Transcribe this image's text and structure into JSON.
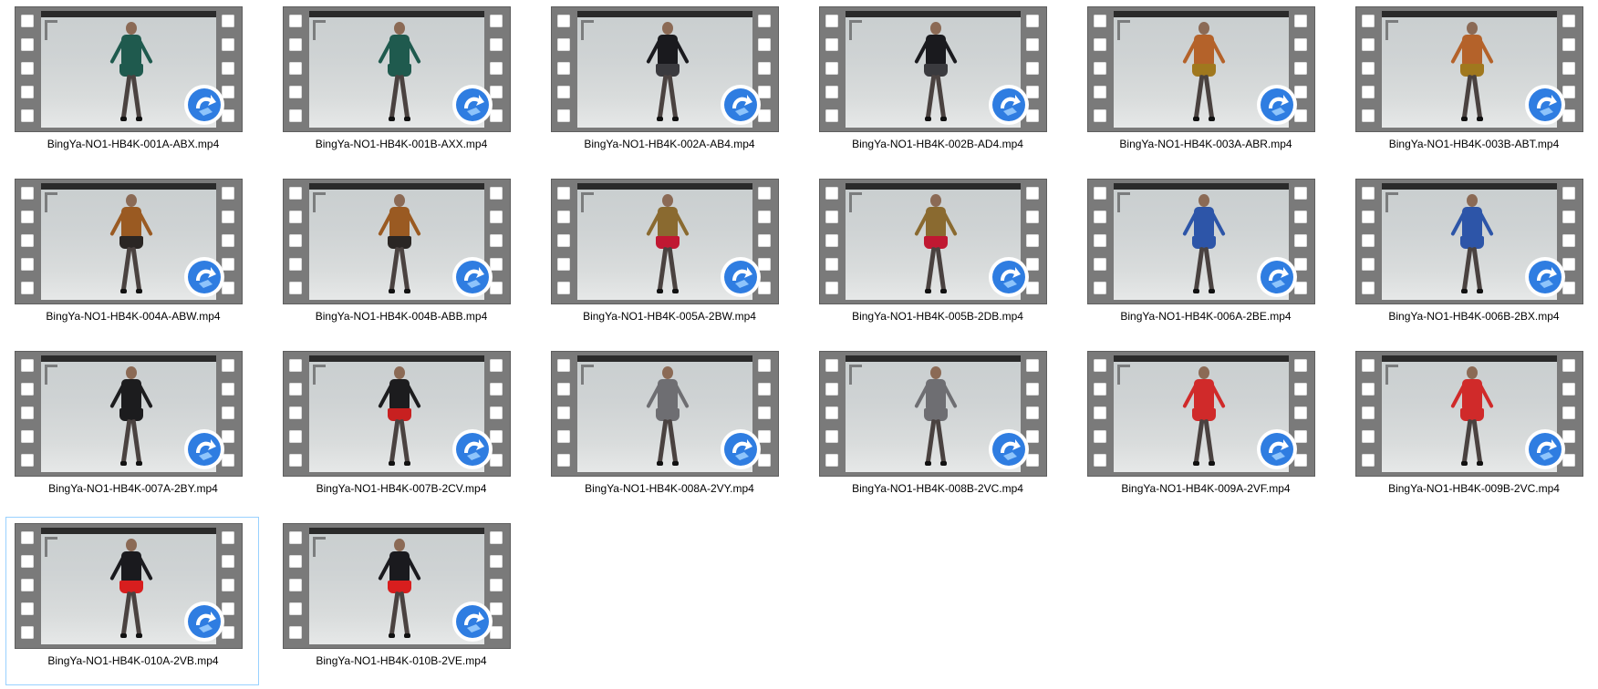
{
  "files": [
    {
      "name": "BingYa-NO1-HB4K-001A-ABX.mp4",
      "top_color": "#1f5a4e",
      "bottom_color": "#1f5a4e",
      "selected": false
    },
    {
      "name": "BingYa-NO1-HB4K-001B-AXX.mp4",
      "top_color": "#1f5a4e",
      "bottom_color": "#1f5a4e",
      "selected": false
    },
    {
      "name": "BingYa-NO1-HB4K-002A-AB4.mp4",
      "top_color": "#1a1a1e",
      "bottom_color": "#3a3a3e",
      "selected": false
    },
    {
      "name": "BingYa-NO1-HB4K-002B-AD4.mp4",
      "top_color": "#1a1a1e",
      "bottom_color": "#3a3a3e",
      "selected": false
    },
    {
      "name": "BingYa-NO1-HB4K-003A-ABR.mp4",
      "top_color": "#b4622a",
      "bottom_color": "#a0781e",
      "selected": false
    },
    {
      "name": "BingYa-NO1-HB4K-003B-ABT.mp4",
      "top_color": "#b4622a",
      "bottom_color": "#a0781e",
      "selected": false
    },
    {
      "name": "BingYa-NO1-HB4K-004A-ABW.mp4",
      "top_color": "#9a5a22",
      "bottom_color": "#2a2624",
      "selected": false
    },
    {
      "name": "BingYa-NO1-HB4K-004B-ABB.mp4",
      "top_color": "#9a5a22",
      "bottom_color": "#2a2624",
      "selected": false
    },
    {
      "name": "BingYa-NO1-HB4K-005A-2BW.mp4",
      "top_color": "#8a6a30",
      "bottom_color": "#c01832",
      "selected": false
    },
    {
      "name": "BingYa-NO1-HB4K-005B-2DB.mp4",
      "top_color": "#8a6a30",
      "bottom_color": "#c01832",
      "selected": false
    },
    {
      "name": "BingYa-NO1-HB4K-006A-2BE.mp4",
      "top_color": "#2d55a8",
      "bottom_color": "#2d55a8",
      "selected": false
    },
    {
      "name": "BingYa-NO1-HB4K-006B-2BX.mp4",
      "top_color": "#2d55a8",
      "bottom_color": "#2d55a8",
      "selected": false
    },
    {
      "name": "BingYa-NO1-HB4K-007A-2BY.mp4",
      "top_color": "#1c1c1e",
      "bottom_color": "#1c1c1e",
      "selected": false
    },
    {
      "name": "BingYa-NO1-HB4K-007B-2CV.mp4",
      "top_color": "#1c1c1e",
      "bottom_color": "#c82020",
      "selected": false
    },
    {
      "name": "BingYa-NO1-HB4K-008A-2VY.mp4",
      "top_color": "#6e6e72",
      "bottom_color": "#6e6e72",
      "selected": false
    },
    {
      "name": "BingYa-NO1-HB4K-008B-2VC.mp4",
      "top_color": "#6e6e72",
      "bottom_color": "#6e6e72",
      "selected": false
    },
    {
      "name": "BingYa-NO1-HB4K-009A-2VF.mp4",
      "top_color": "#d02a2a",
      "bottom_color": "#d02a2a",
      "selected": false
    },
    {
      "name": "BingYa-NO1-HB4K-009B-2VC.mp4",
      "top_color": "#d02a2a",
      "bottom_color": "#d02a2a",
      "selected": false
    },
    {
      "name": "BingYa-NO1-HB4K-010A-2VB.mp4",
      "top_color": "#1a1a1e",
      "bottom_color": "#d81e1e",
      "selected": true
    },
    {
      "name": "BingYa-NO1-HB4K-010B-2VE.mp4",
      "top_color": "#1a1a1e",
      "bottom_color": "#d81e1e",
      "selected": false
    }
  ],
  "icons": {
    "thumbnail_overlay": "video-player-app-icon",
    "thumbnail_frame": "film-strip-icon"
  },
  "colors": {
    "selection_border": "#99d1ff",
    "badge_blue": "#2f7de1"
  }
}
